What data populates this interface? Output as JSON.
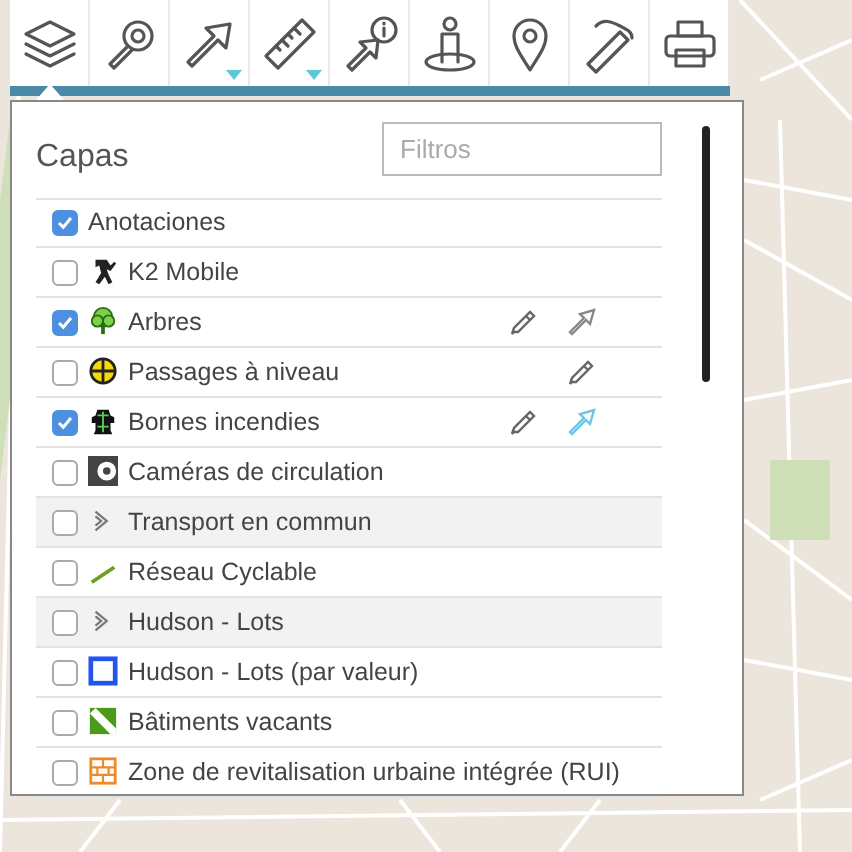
{
  "toolbar": {
    "tools": [
      {
        "kind": "layers",
        "selected": true,
        "dropdown": false
      },
      {
        "kind": "search",
        "selected": false,
        "dropdown": false
      },
      {
        "kind": "arrow",
        "selected": false,
        "dropdown": true
      },
      {
        "kind": "ruler",
        "selected": false,
        "dropdown": true
      },
      {
        "kind": "identify",
        "selected": false,
        "dropdown": false
      },
      {
        "kind": "person",
        "selected": false,
        "dropdown": false
      },
      {
        "kind": "pin",
        "selected": false,
        "dropdown": false
      },
      {
        "kind": "pencil",
        "selected": false,
        "dropdown": false
      },
      {
        "kind": "print",
        "selected": false,
        "dropdown": false
      }
    ]
  },
  "layers_panel": {
    "title": "Capas",
    "filter": {
      "placeholder": "Filtros"
    },
    "layers": [
      {
        "kind": "layer",
        "label": "Anotaciones",
        "checked": true,
        "editable": false
      },
      {
        "kind": "layer",
        "label": "K2 Mobile",
        "checked": false,
        "editable": false
      },
      {
        "kind": "layer",
        "label": "Arbres",
        "checked": true,
        "editable": true,
        "zoom": {
          "active": false
        }
      },
      {
        "kind": "layer",
        "label": "Passages à niveau",
        "checked": false,
        "editable": true
      },
      {
        "kind": "layer",
        "label": "Bornes incendies",
        "checked": true,
        "editable": true,
        "zoom": {
          "active": true
        }
      },
      {
        "kind": "layer",
        "label": "Caméras de circulation",
        "checked": false,
        "editable": false
      },
      {
        "kind": "group",
        "label": "Transport en commun",
        "checked": false,
        "editable": false
      },
      {
        "kind": "layer",
        "label": "Réseau Cyclable",
        "checked": false,
        "editable": false
      },
      {
        "kind": "group",
        "label": "Hudson - Lots",
        "checked": false,
        "editable": false
      },
      {
        "kind": "layer",
        "label": "Hudson - Lots (par valeur)",
        "checked": false,
        "editable": false
      },
      {
        "kind": "layer",
        "label": "Bâtiments vacants",
        "checked": false,
        "editable": false
      },
      {
        "kind": "layer",
        "label": "Zone de revitalisation urbaine intégrée (RUI)",
        "checked": false,
        "editable": false
      }
    ]
  }
}
